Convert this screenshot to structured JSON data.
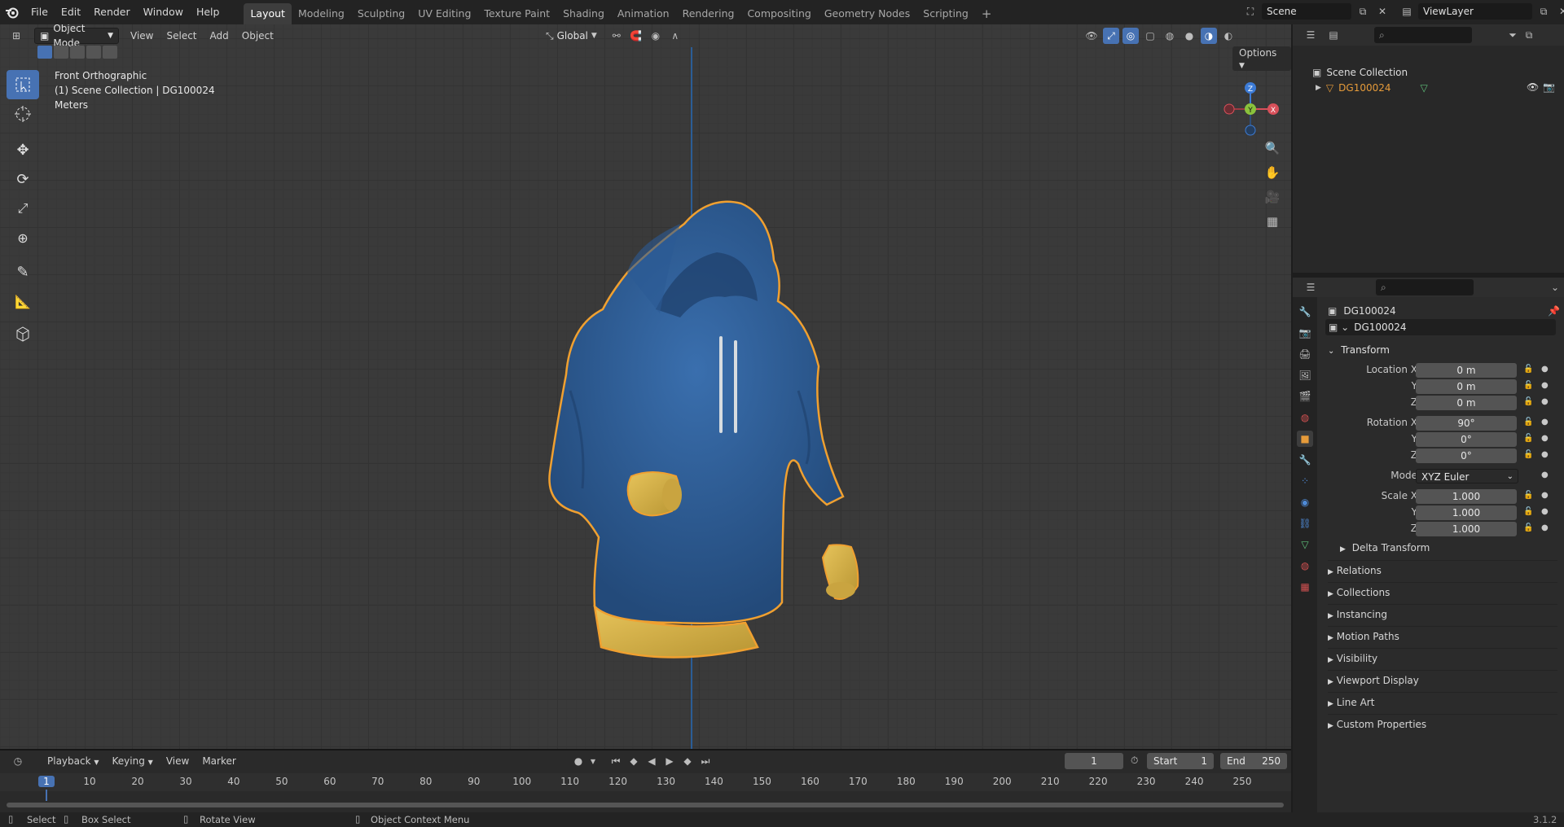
{
  "topbar": {
    "menus": [
      "File",
      "Edit",
      "Render",
      "Window",
      "Help"
    ],
    "workspaces": [
      "Layout",
      "Modeling",
      "Sculpting",
      "UV Editing",
      "Texture Paint",
      "Shading",
      "Animation",
      "Rendering",
      "Compositing",
      "Geometry Nodes",
      "Scripting"
    ],
    "active_workspace": "Layout",
    "add_tab": "+",
    "scene": "Scene",
    "view_layer": "ViewLayer"
  },
  "viewport": {
    "mode": "Object Mode",
    "menus": [
      "View",
      "Select",
      "Add",
      "Object"
    ],
    "orientation": "Global",
    "options": "Options",
    "overlay_lines": [
      "Front Orthographic",
      "(1) Scene Collection | DG100024",
      "Meters"
    ],
    "gizmo": {
      "z": "Z",
      "y": "Y",
      "x": "X"
    }
  },
  "outliner": {
    "root": "Scene Collection",
    "object": "DG100024"
  },
  "properties": {
    "object_name": "DG100024",
    "data_name": "DG100024",
    "transform_label": "Transform",
    "location": {
      "label_x": "Location X",
      "label_y": "Y",
      "label_z": "Z",
      "x": "0 m",
      "y": "0 m",
      "z": "0 m"
    },
    "rotation": {
      "label_x": "Rotation X",
      "label_y": "Y",
      "label_z": "Z",
      "x": "90°",
      "y": "0°",
      "z": "0°"
    },
    "mode": {
      "label": "Mode",
      "value": "XYZ Euler"
    },
    "scale": {
      "label_x": "Scale X",
      "label_y": "Y",
      "label_z": "Z",
      "x": "1.000",
      "y": "1.000",
      "z": "1.000"
    },
    "delta": "Delta Transform",
    "panels": [
      "Relations",
      "Collections",
      "Instancing",
      "Motion Paths",
      "Visibility",
      "Viewport Display",
      "Line Art",
      "Custom Properties"
    ]
  },
  "timeline": {
    "menus": [
      "Playback",
      "Keying",
      "View",
      "Marker"
    ],
    "current_frame": "1",
    "start_label": "Start",
    "start": "1",
    "end_label": "End",
    "end": "250",
    "ticks": [
      "1",
      "10",
      "20",
      "30",
      "40",
      "50",
      "60",
      "70",
      "80",
      "90",
      "100",
      "110",
      "120",
      "130",
      "140",
      "150",
      "160",
      "170",
      "180",
      "190",
      "200",
      "210",
      "220",
      "230",
      "240",
      "250"
    ]
  },
  "status": {
    "select": "Select",
    "box_select": "Box Select",
    "rotate_view": "Rotate View",
    "context_menu": "Object Context Menu",
    "version": "3.1.2"
  },
  "colors": {
    "accent": "#4772b3",
    "hoodie": "#2f5f99",
    "cuff": "#d9b54a",
    "selection": "#f0a030"
  }
}
